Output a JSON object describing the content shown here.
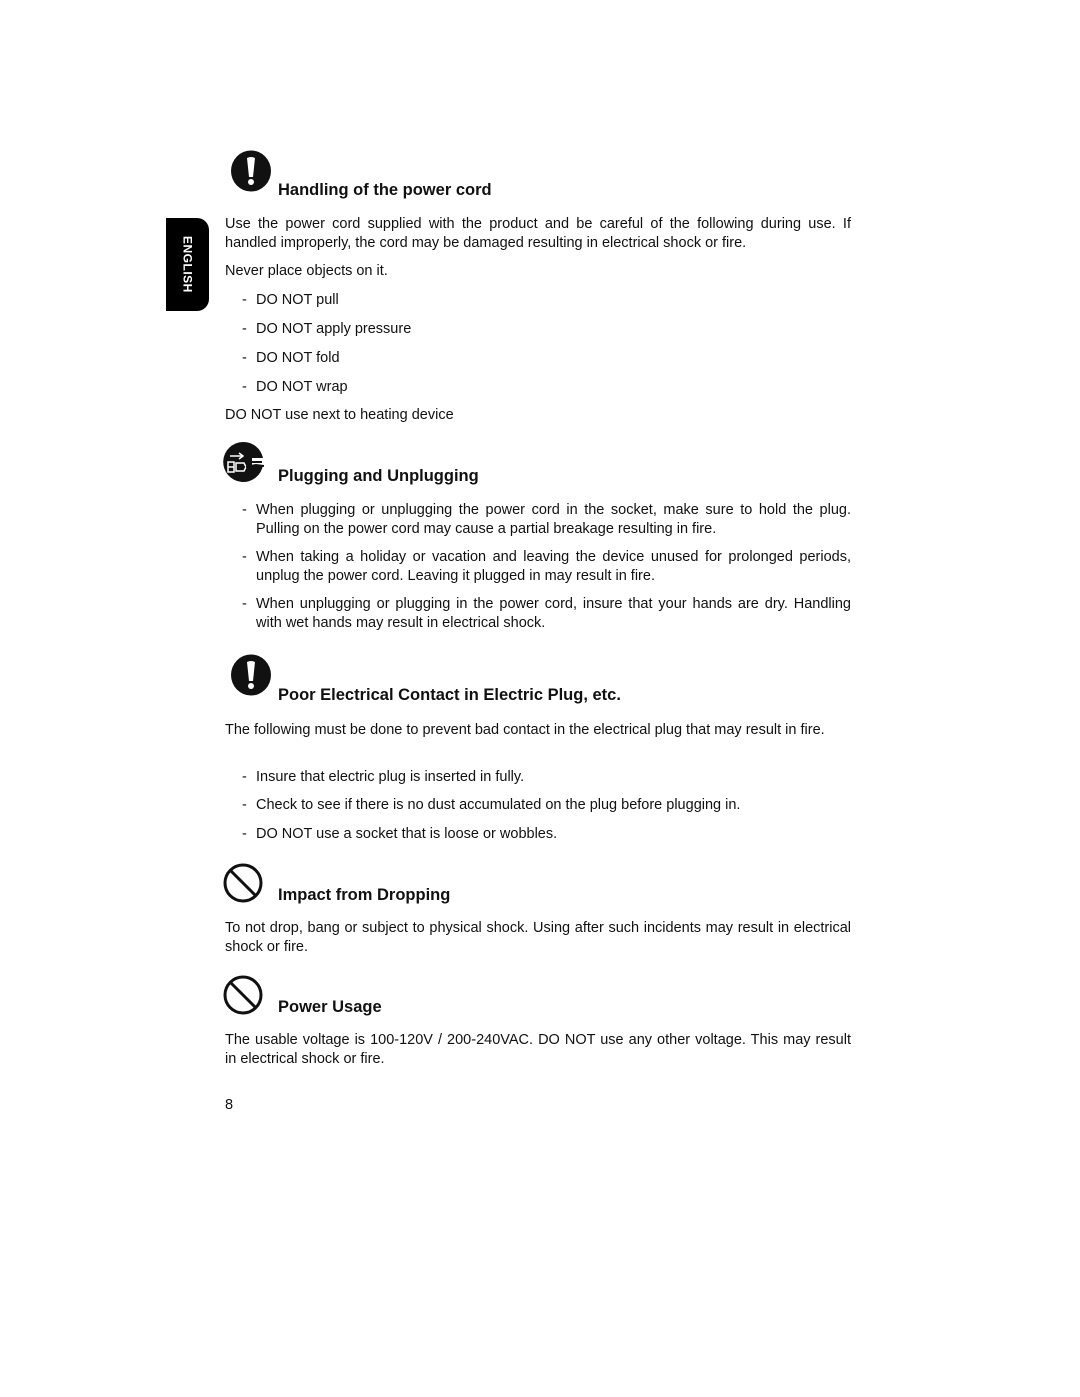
{
  "side_tab": {
    "label": "ENGLISH"
  },
  "sections": [
    {
      "icon": "exclamation-icon",
      "heading": "Handling of the power cord",
      "paragraphs": [
        "Use the power cord supplied with the product and be careful of the following during use. If handled improperly, the cord may be damaged resulting in electrical shock or fire.",
        "Never place objects on it."
      ],
      "bullets": [
        "DO NOT pull",
        "DO NOT apply pressure",
        "DO NOT fold",
        "DO NOT wrap"
      ],
      "after": "DO NOT use next to heating device"
    },
    {
      "icon": "unplug-icon",
      "heading": "Plugging and Unplugging",
      "bullets": [
        "When plugging or unplugging the power cord in the socket, make sure to hold the plug. Pulling on the power cord may cause a partial breakage resulting in fire.",
        "When taking a holiday or vacation and leaving the device unused for prolonged periods, unplug the power cord. Leaving it plugged in may result in fire.",
        "When unplugging or plugging in the power cord, insure that your hands are dry. Handling with wet hands may result in electrical shock."
      ]
    },
    {
      "icon": "exclamation-icon",
      "heading": "Poor Electrical Contact in Electric Plug, etc.",
      "paragraphs": [
        "The following must be done to prevent bad contact in the electrical plug that may result in fire."
      ],
      "bullets": [
        "Insure that electric plug is inserted in fully.",
        "Check to see if there is no dust accumulated on the plug before plugging in.",
        "DO NOT use a socket that is loose or wobbles."
      ]
    },
    {
      "icon": "prohibited-icon",
      "heading": "Impact from Dropping",
      "paragraphs": [
        "To not drop, bang or subject to physical shock. Using after such incidents may result in electrical shock or fire."
      ]
    },
    {
      "icon": "prohibited-icon",
      "heading": "Power Usage",
      "paragraphs": [
        "The usable voltage is 100-120V / 200-240VAC.  DO NOT use any other voltage. This may result in electrical shock or fire."
      ]
    }
  ],
  "bullet_marker": "-",
  "page_number": "8"
}
